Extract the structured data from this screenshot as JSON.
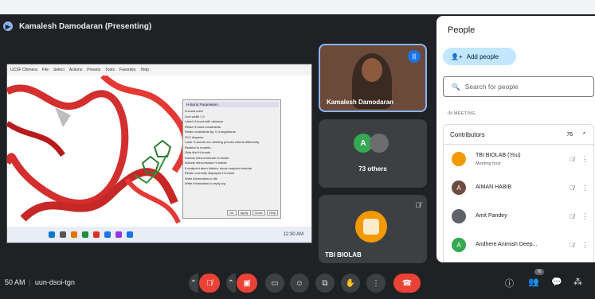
{
  "presenter": {
    "initial": "",
    "label": "Kamalesh Damodaran (Presenting)"
  },
  "shared_screen": {
    "window_title": "UCSF Chimera",
    "menu": [
      "File",
      "Select",
      "Actions",
      "Presets",
      "Tools",
      "Favorites",
      "Help"
    ],
    "dialog": {
      "title": "H-Bond Parameters",
      "rows": [
        "H-bond color",
        "Line width  1.0",
        "Label H-bond with distance",
        "Relax H-bond constraints",
        "Relax constraints by:  0.4  angstroms",
        "20.0  degrees",
        "Color H-bonds not meeting precise criteria differently",
        "Restrict to models...",
        "Only find H-bonds",
        "Include intra-molecule H-bonds",
        "Include intra-residue H-bonds",
        "If endpoint atom hidden, show endpoint residue",
        "Retain currently displayed H-bonds",
        "Write information to file",
        "Write information to reply log"
      ],
      "buttons": [
        "OK",
        "Apply",
        "Close",
        "Help"
      ]
    },
    "taskbar_time": "12:30 AM"
  },
  "tiles": {
    "presenter_tile_name": "Kamalesh Damodaran",
    "others_initial": "A",
    "others_label": "73 others",
    "host_tile_name": "TBI BIOLAB"
  },
  "people_panel": {
    "title": "People",
    "add_people": "Add people",
    "search_placeholder": "Search for people",
    "section": "IN MEETING",
    "group_label": "Contributors",
    "group_count": "76",
    "participants": [
      {
        "initial": "",
        "name": "TBI BIOLAB (You)",
        "sub": "Meeting host",
        "color": "#f29900"
      },
      {
        "initial": "A",
        "name": "AIMAN HABIB",
        "sub": "",
        "color": "#6d4c41"
      },
      {
        "initial": "",
        "name": "Amit Pandey",
        "sub": "",
        "color": "#5f6368"
      },
      {
        "initial": "A",
        "name": "Andhere Animish Deep...",
        "sub": "",
        "color": "#34a853"
      }
    ]
  },
  "bottom_bar": {
    "time": "50 AM",
    "meeting_code": "uun-dsoi-tgn",
    "people_badge": "76"
  },
  "colors": {
    "accent": "#8ab4f8",
    "end_call": "#ea4335",
    "panel_bg": "#ffffff",
    "app_bg": "#202124"
  }
}
